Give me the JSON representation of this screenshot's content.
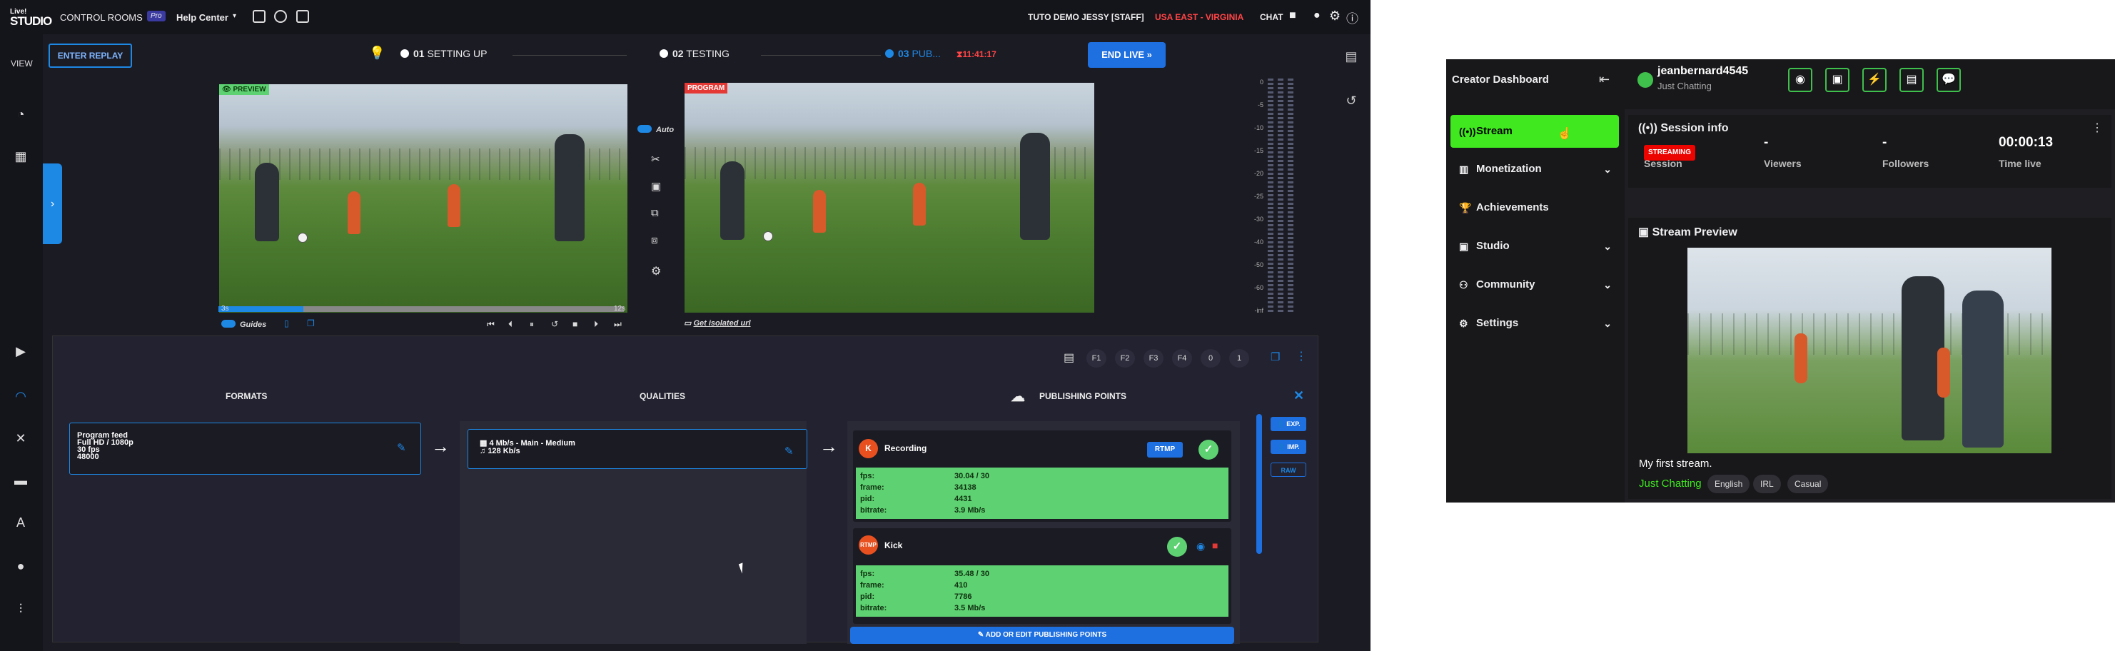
{
  "topbar": {
    "logo_line1": "Live!",
    "logo_line2": "STUDIO",
    "control_rooms": "CONTROL ROOMS",
    "plan_badge": "Pro",
    "help_center": "Help Center",
    "account": "TUTO DEMO JESSY [STAFF]",
    "region": "USA EAST - VIRGINIA",
    "chat": "CHAT"
  },
  "left_sidebar": {
    "view_label": "VIEW"
  },
  "studio": {
    "enter_replay": "ENTER REPLAY",
    "steps": [
      {
        "num": "01",
        "label": "SETTING UP"
      },
      {
        "num": "02",
        "label": "TESTING"
      },
      {
        "num": "03",
        "label": "PUB..."
      }
    ],
    "live_timer": "11:41:17",
    "end_live": "END LIVE",
    "preview_label": "PREVIEW",
    "program_label": "PROGRAM",
    "auto_label": "Auto",
    "progress_start": "3s",
    "progress_end": "12s",
    "progress_value": 0.21,
    "guides_label": "Guides",
    "isolated_url": "Get isolated url",
    "meter_ticks": [
      "0",
      "-5",
      "-10",
      "-15",
      "-20",
      "-25",
      "-30",
      "-40",
      "-50",
      "-60",
      "-inf"
    ]
  },
  "panel": {
    "fkeys": [
      "F1",
      "F2",
      "F3",
      "F4",
      "0",
      "1"
    ],
    "formats_title": "FORMATS",
    "qualities_title": "QUALITIES",
    "publishing_title": "PUBLISHING POINTS",
    "format": {
      "name": "Program feed",
      "resolution": "Full HD / 1080p",
      "fps": "30 fps",
      "audio": "48000"
    },
    "quality": {
      "video": "4 Mb/s - Main - Medium",
      "audio": "128 Kb/s"
    },
    "publishing_points": [
      {
        "name": "Recording",
        "tag": "RTMP",
        "stats": [
          {
            "label": "fps:",
            "value": "30.04 / 30"
          },
          {
            "label": "frame:",
            "value": "34138"
          },
          {
            "label": "pid:",
            "value": "4431"
          },
          {
            "label": "bitrate:",
            "value": "3.9 Mb/s"
          }
        ]
      },
      {
        "name": "Kick",
        "stats": [
          {
            "label": "fps:",
            "value": "35.48 / 30"
          },
          {
            "label": "frame:",
            "value": "410"
          },
          {
            "label": "pid:",
            "value": "7786"
          },
          {
            "label": "bitrate:",
            "value": "3.5 Mb/s"
          }
        ]
      }
    ],
    "add_button": "ADD OR EDIT PUBLISHING POINTS",
    "side_buttons": [
      "EXP.",
      "IMP.",
      "RAW"
    ]
  },
  "dashboard": {
    "title": "Creator Dashboard",
    "username": "jeanbernard4545",
    "category": "Just Chatting",
    "nav": [
      {
        "label": "Stream",
        "icon": "broadcast-icon",
        "active": true
      },
      {
        "label": "Monetization",
        "icon": "chart-icon",
        "chevron": true
      },
      {
        "label": "Achievements",
        "icon": "trophy-icon"
      },
      {
        "label": "Studio",
        "icon": "studio-icon",
        "chevron": true
      },
      {
        "label": "Community",
        "icon": "community-icon",
        "chevron": true
      },
      {
        "label": "Settings",
        "icon": "gear-icon",
        "chevron": true
      }
    ],
    "session_info_title": "Session info",
    "streaming_badge": "STREAMING",
    "stats": [
      {
        "value": "",
        "label": "Session"
      },
      {
        "value": "-",
        "label": "Viewers"
      },
      {
        "value": "-",
        "label": "Followers"
      },
      {
        "value": "00:00:13",
        "label": "Time live"
      }
    ],
    "stream_preview_title": "Stream Preview",
    "stream_title": "My first stream.",
    "game": "Just Chatting",
    "tags": [
      "English",
      "IRL",
      "Casual"
    ]
  },
  "colors": {
    "accent_blue": "#1e88e5",
    "live_red": "#e53935",
    "kick_green": "#3fe81f",
    "stats_green": "#5ed172"
  }
}
